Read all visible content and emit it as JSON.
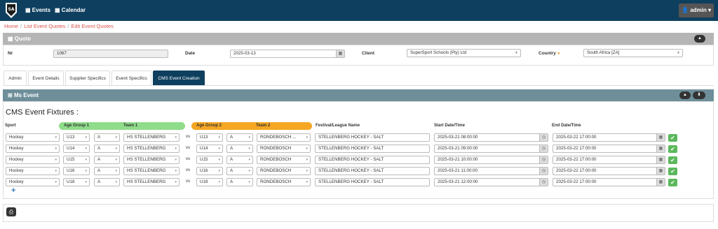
{
  "nav": {
    "logo_text": "SA",
    "events": "Events",
    "calendar": "Calendar",
    "admin": "admin"
  },
  "breadcrumb": [
    "Home",
    "List Event Quotes",
    "Edit Event Quotes"
  ],
  "quote": {
    "title": "Quote",
    "nr_label": "Nr",
    "nr_value": "1067",
    "date_label": "Date",
    "date_value": "2025-03-13",
    "client_label": "Client",
    "client_value": "SuperSport Schools (Pty) Ltd",
    "country_label": "Country",
    "country_value": "South Africa [ZA]"
  },
  "tabs": [
    "Admin",
    "Event Details",
    "Supplier Specifics",
    "Event Specifics",
    "CMS Event Creation"
  ],
  "ms_event": {
    "title": "Ms Event",
    "section_title": "CMS Event Fixtures :",
    "headers": {
      "sport": "Sport",
      "age_group_1": "Age Group 1",
      "team_1": "Team 1",
      "age_group_2": "Age Group 2",
      "team_2": "Team 2",
      "festival": "Festival/League Name",
      "start": "Start Date/Time",
      "end": "End Date/Time"
    },
    "vs_label": "vs",
    "rows": [
      {
        "sport": "Hockey",
        "age1": "U13",
        "div1": "A",
        "team1": "HS STELLENBERG",
        "age2": "U13",
        "div2": "A",
        "team2": "RONDEBOSCH ...",
        "festival": "STELLENBERG HOCKEY - SALT",
        "start": "2025-03-21 08:00:00",
        "end": "2025-03-22 17:00:00"
      },
      {
        "sport": "Hockey",
        "age1": "U14",
        "div1": "A",
        "team1": "HS STELLENBERG",
        "age2": "U14",
        "div2": "A",
        "team2": "RONDEBOSCH",
        "festival": "STELLENBERG HOCKEY - SALT",
        "start": "2025-03-21 09:00:00",
        "end": "2025-03-22 17:00:00"
      },
      {
        "sport": "Hockey",
        "age1": "U15",
        "div1": "A",
        "team1": "HS STELLENBERG",
        "age2": "U15",
        "div2": "A",
        "team2": "RONDEBOSCH",
        "festival": "STELLENBERG HOCKEY - SALT",
        "start": "2025-03-21 10:00:00",
        "end": "2025-03-22 17:00:00"
      },
      {
        "sport": "Hockey",
        "age1": "U16",
        "div1": "A",
        "team1": "HS STELLENBERG",
        "age2": "U16",
        "div2": "A",
        "team2": "RONDEBOSCH",
        "festival": "STELLENBERG HOCKEY - SALT",
        "start": "2025-03-21 11:00:00",
        "end": "2025-03-22 17:00:00"
      },
      {
        "sport": "Hockey",
        "age1": "U18",
        "div1": "A",
        "team1": "HS STELLENBERG",
        "age2": "U18",
        "div2": "A",
        "team2": "RONDEBOSCH",
        "festival": "STELLENBERG HOCKEY - SALT",
        "start": "2025-03-21 12:00:00",
        "end": "2025-03-22 17:00:00"
      }
    ]
  },
  "icons": {
    "caret": "▾",
    "chevron_up": "▲",
    "download": "⬇",
    "calendar": "▦",
    "clock": "◷",
    "check": "✔",
    "plus": "+",
    "print": "⎙",
    "country_dot": "●"
  },
  "colors": {
    "nav_bg": "#0e3f5e",
    "quote_head": "#b5b5b5",
    "ms_head": "#6e8f9a",
    "age1_green": "#8fdc8a",
    "age2_orange": "#f5a623",
    "ok_green": "#5cb85c",
    "breadcrumb_red": "#d9534f"
  }
}
